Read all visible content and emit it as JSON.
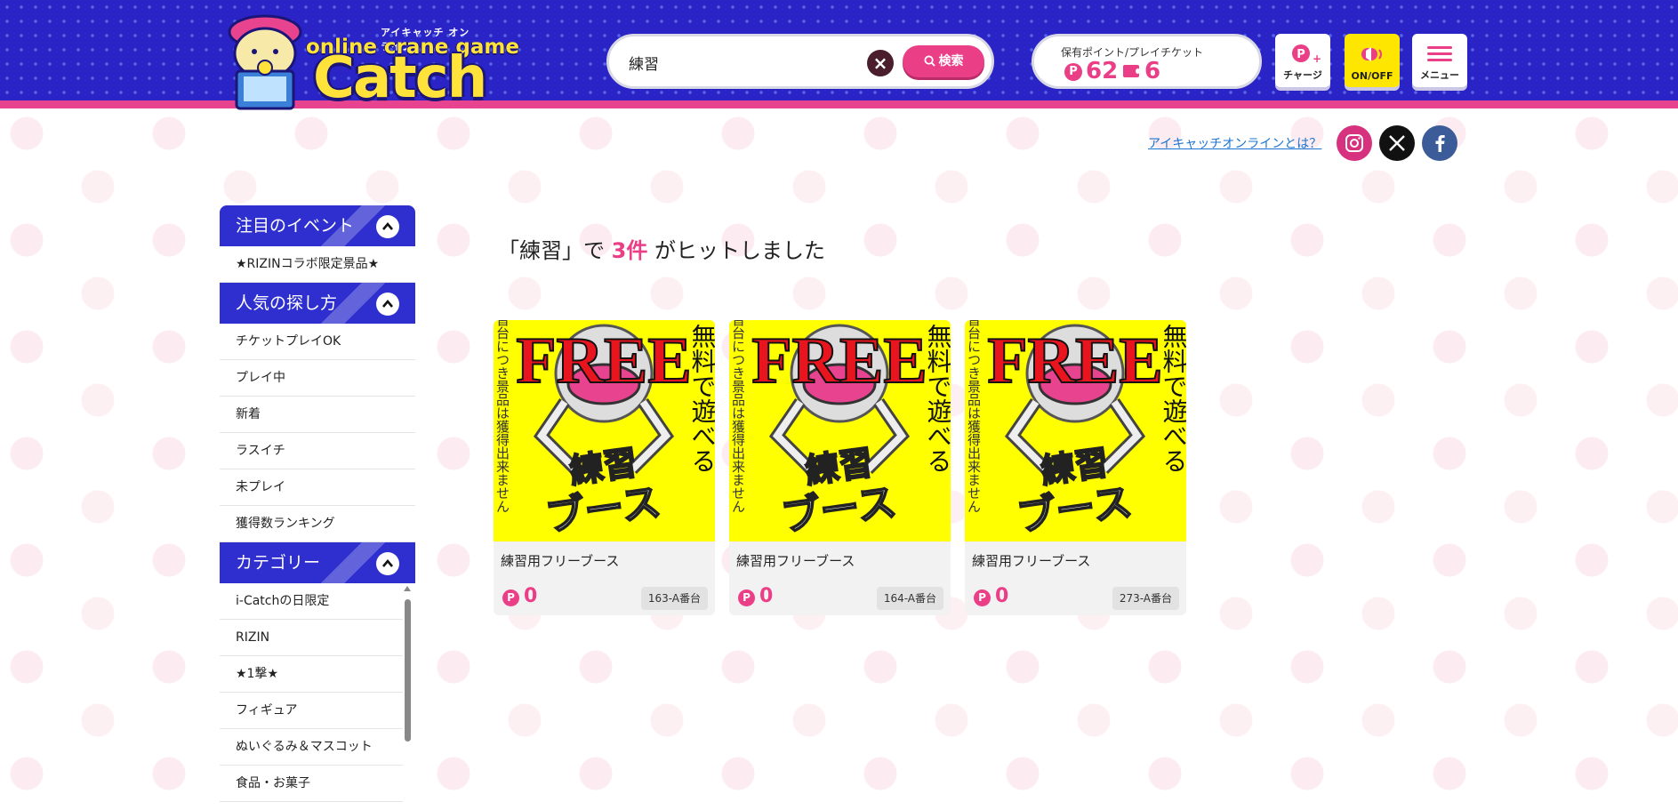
{
  "header": {
    "logo_small": "アイキャッチ オンライン",
    "logo_sub": "online crane game",
    "logo_main": "Catch",
    "search": {
      "value": "練習",
      "button_label": "検索"
    },
    "points": {
      "label": "保有ポイント/プレイチケット",
      "points": "62",
      "tickets": "6"
    },
    "buttons": {
      "charge": "チャージ",
      "sound": "ON/OFF",
      "menu": "メニュー"
    }
  },
  "subheader": {
    "about_link": "アイキャッチオンラインとは？"
  },
  "sidebar": {
    "event_title": "注目のイベント",
    "events": [
      "★RIZINコラボ限定景品★"
    ],
    "popular_title": "人気の探し方",
    "popular": [
      "チケットプレイOK",
      "プレイ中",
      "新着",
      "ラスイチ",
      "未プレイ",
      "獲得数ランキング"
    ],
    "category_title": "カテゴリー",
    "categories": [
      "i-Catchの日限定",
      "RIZIN",
      "★1撃★",
      "フィギュア",
      "ぬいぐるみ＆マスコット",
      "食品・お菓子"
    ]
  },
  "results": {
    "prefix": "「練習」で",
    "count": "3件",
    "suffix": "がヒットしました"
  },
  "cards": [
    {
      "title": "練習用フリーブース",
      "price": "0",
      "booth": "163-A番台"
    },
    {
      "title": "練習用フリーブース",
      "price": "0",
      "booth": "164-A番台"
    },
    {
      "title": "練習用フリーブース",
      "price": "0",
      "booth": "273-A番台"
    }
  ],
  "card_image": {
    "free": "FREE",
    "right": "無料で遊べる",
    "left": "※練習台につき景品は獲得出来ません",
    "center_top": "練習",
    "center_bottom": "ブース"
  },
  "colors": {
    "brand_blue": "#2a24c6",
    "accent_pink": "#ea3e87",
    "yellow": "#ffe600"
  }
}
